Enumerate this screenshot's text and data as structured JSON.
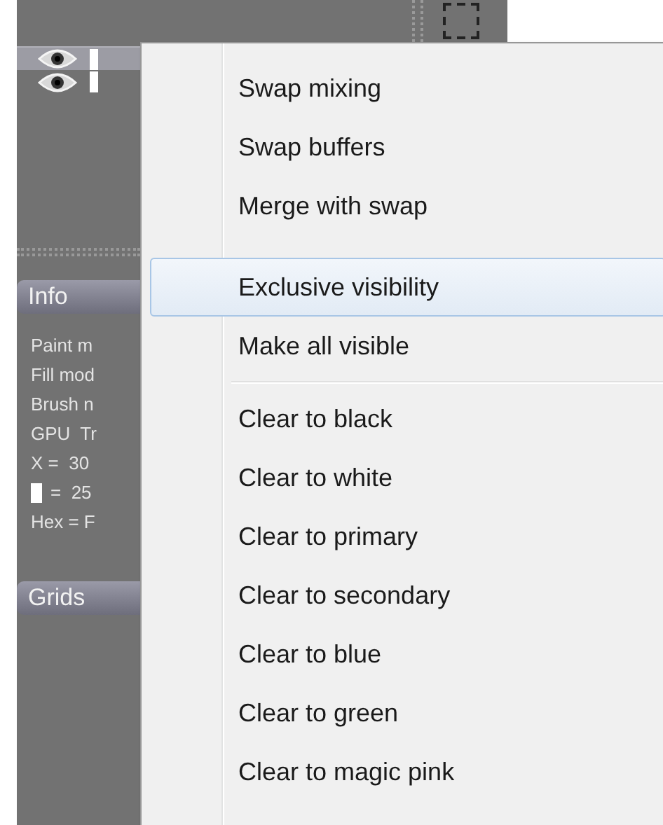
{
  "layers": [
    {
      "selected": true
    },
    {
      "selected": false
    }
  ],
  "info": {
    "header": "Info",
    "lines": [
      {
        "kind": "text",
        "text": "Paint m"
      },
      {
        "kind": "text",
        "text": "Fill mod"
      },
      {
        "kind": "text",
        "text": "Brush n"
      },
      {
        "kind": "text",
        "text": "GPU  Tr"
      },
      {
        "kind": "text",
        "text": "X =  30"
      },
      {
        "kind": "swatch",
        "text": "=  25"
      },
      {
        "kind": "text",
        "text": "Hex = F"
      }
    ]
  },
  "grids": {
    "header": "Grids"
  },
  "menu": [
    {
      "kind": "item",
      "label": "Swap mixing",
      "selected": false
    },
    {
      "kind": "item",
      "label": "Swap buffers",
      "selected": false
    },
    {
      "kind": "item",
      "label": "Merge with swap",
      "selected": false
    },
    {
      "kind": "gap"
    },
    {
      "kind": "item",
      "label": "Exclusive visibility",
      "selected": true
    },
    {
      "kind": "item",
      "label": "Make all visible",
      "selected": false
    },
    {
      "kind": "separator"
    },
    {
      "kind": "item",
      "label": "Clear to black",
      "selected": false
    },
    {
      "kind": "item",
      "label": "Clear to white",
      "selected": false
    },
    {
      "kind": "item",
      "label": "Clear to primary",
      "selected": false
    },
    {
      "kind": "item",
      "label": "Clear to secondary",
      "selected": false
    },
    {
      "kind": "item",
      "label": "Clear to blue",
      "selected": false
    },
    {
      "kind": "item",
      "label": "Clear to green",
      "selected": false
    },
    {
      "kind": "item",
      "label": "Clear to magic pink",
      "selected": false
    }
  ]
}
